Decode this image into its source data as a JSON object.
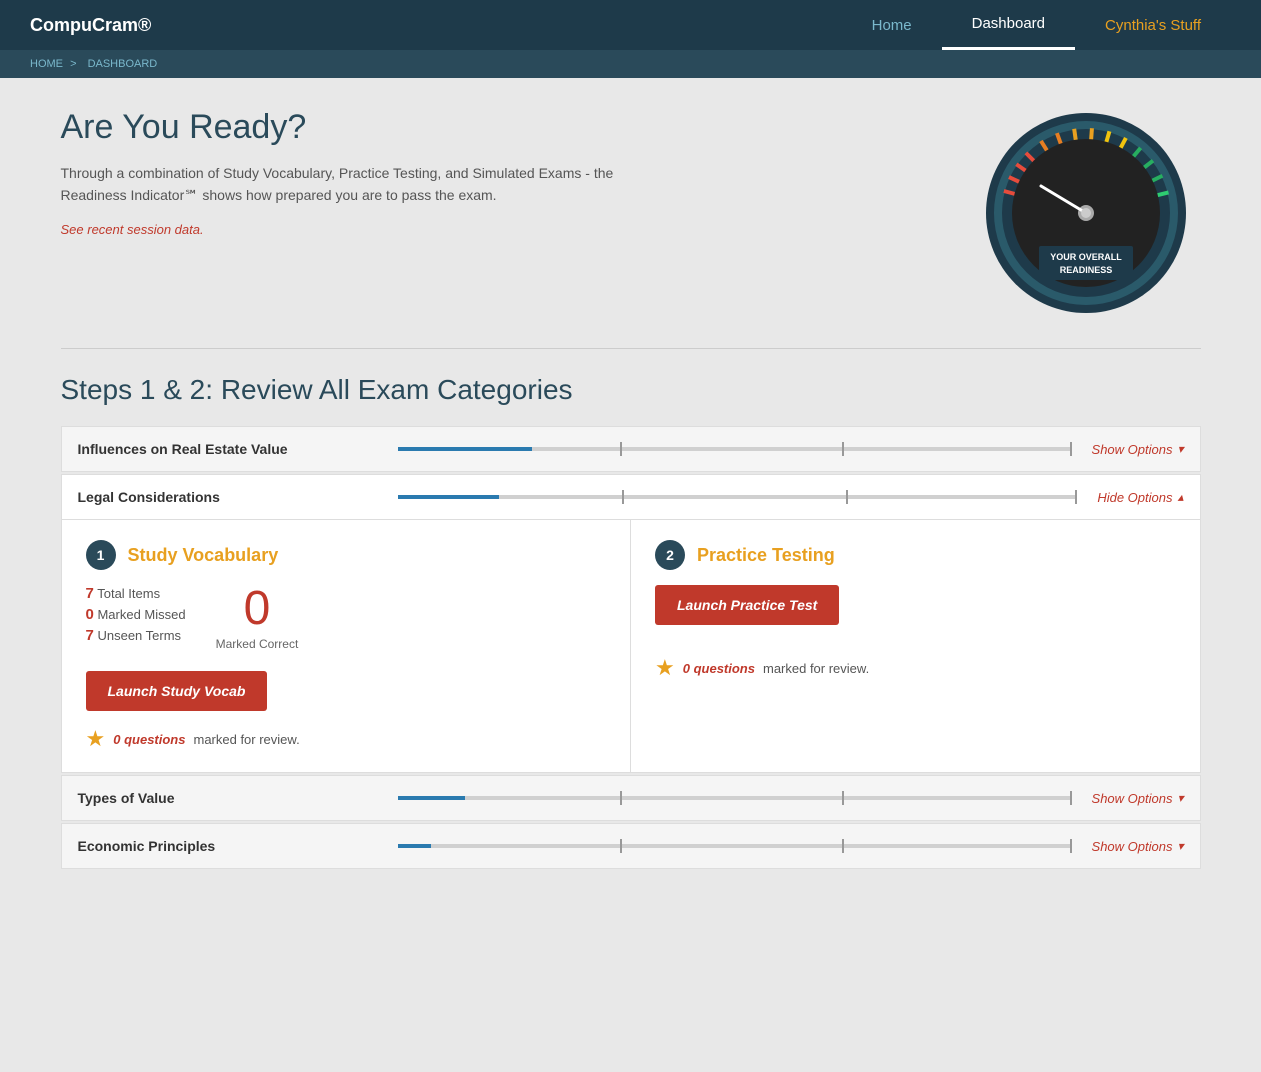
{
  "nav": {
    "brand": "CompuCram",
    "brand_prefix": "Compu",
    "brand_bold": "Cram®",
    "links": [
      {
        "label": "Home",
        "active": false,
        "special": false
      },
      {
        "label": "Dashboard",
        "active": true,
        "special": false
      },
      {
        "label": "Cynthia's Stuff",
        "active": false,
        "special": true
      }
    ]
  },
  "breadcrumb": {
    "home": "HOME",
    "separator": ">",
    "current": "DASHBOARD"
  },
  "hero": {
    "title": "Are You Ready?",
    "description": "Through a combination of Study Vocabulary, Practice Testing, and Simulated Exams - the Readiness Indicator℠ shows how prepared you are to pass the exam.",
    "link": "See recent session data.",
    "gauge_label_line1": "YOUR OVERALL",
    "gauge_label_line2": "READINESS"
  },
  "steps_heading": "Steps 1 & 2: Review All Exam Categories",
  "categories": [
    {
      "id": "influences",
      "title": "Influences on Real Estate Value",
      "show_options": "Show Options",
      "expanded": false,
      "progress": 20
    },
    {
      "id": "legal",
      "title": "Legal Considerations",
      "show_options": "Hide Options",
      "expanded": true,
      "progress": 15,
      "study_vocab": {
        "step_num": "1",
        "title": "Study Vocabulary",
        "total_items_label": "Total Items",
        "total_items_val": "7",
        "marked_missed_label": "Marked Missed",
        "marked_missed_val": "0",
        "unseen_terms_label": "Unseen Terms",
        "unseen_terms_val": "7",
        "marked_correct_val": "0",
        "marked_correct_label": "Marked Correct",
        "launch_btn": "Launch Study Vocab",
        "review_count": "0 questions",
        "review_suffix": "marked for review."
      },
      "practice_testing": {
        "step_num": "2",
        "title": "Practice Testing",
        "launch_btn": "Launch Practice Test",
        "review_count": "0 questions",
        "review_suffix": "marked for review."
      }
    },
    {
      "id": "types",
      "title": "Types of Value",
      "show_options": "Show Options",
      "expanded": false,
      "progress": 10
    },
    {
      "id": "economic",
      "title": "Economic Principles",
      "show_options": "Show Options",
      "expanded": false,
      "progress": 5
    }
  ]
}
